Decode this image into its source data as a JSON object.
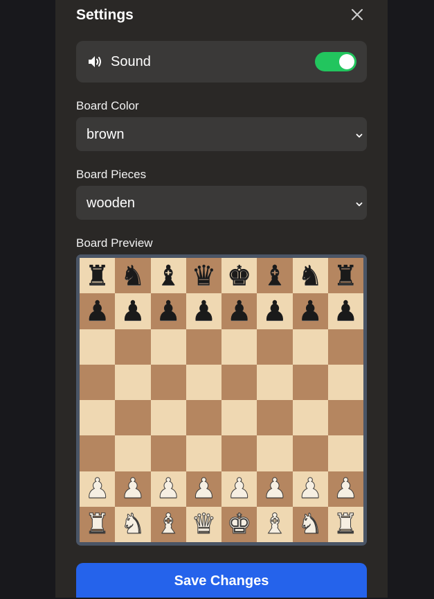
{
  "settings": {
    "title": "Settings",
    "close_icon": "close-icon"
  },
  "sound": {
    "icon": "speaker-icon",
    "label": "Sound",
    "enabled": true,
    "toggle_color": "#22c55e"
  },
  "board_color": {
    "label": "Board Color",
    "value": "brown"
  },
  "board_pieces": {
    "label": "Board Pieces",
    "value": "wooden"
  },
  "board_preview": {
    "label": "Board Preview",
    "light_square_color": "#efd8b2",
    "dark_square_color": "#b58660",
    "ranks": [
      [
        "r",
        "n",
        "b",
        "q",
        "k",
        "b",
        "n",
        "r"
      ],
      [
        "p",
        "p",
        "p",
        "p",
        "p",
        "p",
        "p",
        "p"
      ],
      [
        "",
        "",
        "",
        "",
        "",
        "",
        "",
        ""
      ],
      [
        "",
        "",
        "",
        "",
        "",
        "",
        "",
        ""
      ],
      [
        "",
        "",
        "",
        "",
        "",
        "",
        "",
        ""
      ],
      [
        "",
        "",
        "",
        "",
        "",
        "",
        "",
        ""
      ],
      [
        "P",
        "P",
        "P",
        "P",
        "P",
        "P",
        "P",
        "P"
      ],
      [
        "R",
        "N",
        "B",
        "Q",
        "K",
        "B",
        "N",
        "R"
      ]
    ]
  },
  "save": {
    "label": "Save Changes",
    "color": "#2563eb"
  }
}
